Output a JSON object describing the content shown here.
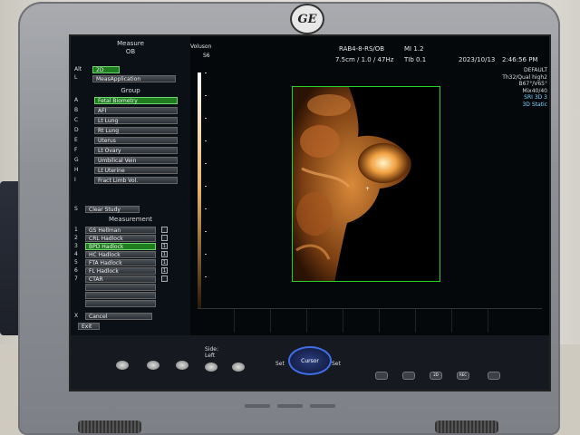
{
  "brand": {
    "logo_text": "GE"
  },
  "left_panel": {
    "title": "Measure",
    "mode": "OB",
    "alt_label": "Alt",
    "mode_2d": "2D",
    "l_label": "L",
    "meas_application": "MeasApplication",
    "group_header": "Group",
    "groups": [
      {
        "key": "A",
        "label": "Fetal Biometry",
        "selected": true
      },
      {
        "key": "B",
        "label": "AFI",
        "selected": false
      },
      {
        "key": "C",
        "label": "Lt Lung",
        "selected": false
      },
      {
        "key": "D",
        "label": "Rt Lung",
        "selected": false
      },
      {
        "key": "E",
        "label": "Uterus",
        "selected": false
      },
      {
        "key": "F",
        "label": "Lt Ovary",
        "selected": false
      },
      {
        "key": "G",
        "label": "Umbilical Vein",
        "selected": false
      },
      {
        "key": "H",
        "label": "Lt Uterine",
        "selected": false
      },
      {
        "key": "I",
        "label": "Fract Limb Vol.",
        "selected": false
      }
    ],
    "clear_study_key": "S",
    "clear_study": "Clear Study",
    "measurement_header": "Measurement",
    "measurements": [
      {
        "key": "1",
        "label": "GS Hellman",
        "check": ""
      },
      {
        "key": "2",
        "label": "CRL Hadlock",
        "check": ""
      },
      {
        "key": "3",
        "label": "BPD Hadlock",
        "check": "1",
        "selected": true
      },
      {
        "key": "4",
        "label": "HC Hadlock",
        "check": "1"
      },
      {
        "key": "5",
        "label": "FTA Hadlock",
        "check": "1"
      },
      {
        "key": "6",
        "label": "FL Hadlock",
        "check": "1"
      },
      {
        "key": "7",
        "label": "CTAR",
        "check": ""
      }
    ],
    "cancel_key": "X",
    "cancel": "Cancel",
    "exit": "Exit"
  },
  "top_bar": {
    "volusion": "Voluson",
    "s6": "S6",
    "probe": "RAB4-8-RS/OB",
    "mi": "MI 1.2",
    "depth_freq": "7.5cm / 1.0 / 47Hz",
    "tib": "TIb 0.1",
    "date": "2023/10/13",
    "time": "2:46:56 PM"
  },
  "info_box": {
    "lines": [
      "DEFAULT",
      "Th32/Qual high2",
      "B67°/V65°",
      "Mix40/40"
    ],
    "sri": "SRI 3D 3",
    "static": "3D Static"
  },
  "controls": {
    "side_label": "Side:",
    "side_value": "Left",
    "set_left": "Set",
    "set_right": "Set",
    "cursor": "Cursor",
    "button_labels": [
      "2D",
      "REC"
    ]
  },
  "colors": {
    "accent_green": "#28d028",
    "select_green": "#1e7d1e",
    "sri_blue": "#7bd7ff",
    "cursor_blue": "#3f6de6"
  }
}
